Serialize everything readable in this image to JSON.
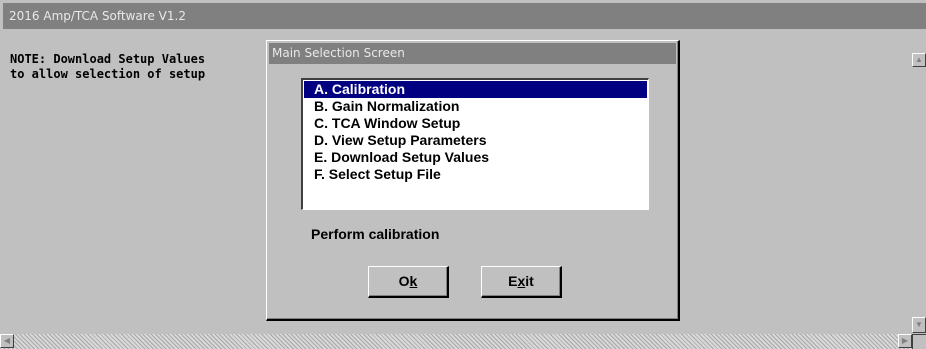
{
  "app": {
    "title": "2016 Amp/TCA Software V1.2"
  },
  "note": {
    "line1": "NOTE: Download Setup Values",
    "line2": "to allow selection of setup"
  },
  "dialog": {
    "title": "Main Selection Screen",
    "items": [
      {
        "label": "A. Calibration",
        "selected": true
      },
      {
        "label": "B. Gain Normalization",
        "selected": false
      },
      {
        "label": "C. TCA Window Setup",
        "selected": false
      },
      {
        "label": "D. View Setup Parameters",
        "selected": false
      },
      {
        "label": "E. Download Setup Values",
        "selected": false
      },
      {
        "label": "F. Select Setup File",
        "selected": false
      }
    ],
    "description": "Perform calibration",
    "buttons": {
      "ok": {
        "pre": "O",
        "accel": "k",
        "post": ""
      },
      "exit": {
        "pre": "E",
        "accel": "x",
        "post": "it"
      }
    }
  },
  "colors": {
    "selection": "#000080",
    "face": "#c0c0c0",
    "titlebar": "#808080"
  }
}
